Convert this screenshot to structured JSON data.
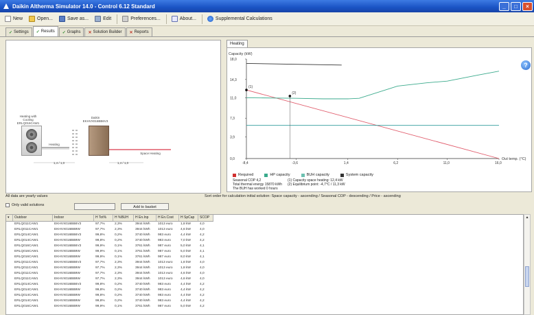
{
  "window": {
    "title": "Daikin Altherma Simulator 14.0 - Control 6.12 Standard"
  },
  "toolbar": {
    "items": [
      "New",
      "Open...",
      "Save as...",
      "Edit",
      "Preferences...",
      "About...",
      "Supplemental Calculations"
    ]
  },
  "tabs": [
    {
      "label": "Settings",
      "state": "done"
    },
    {
      "label": "Results",
      "state": "done",
      "active": true
    },
    {
      "label": "Graphs",
      "state": "done"
    },
    {
      "label": "Solution Builder",
      "state": "error"
    },
    {
      "label": "Reports",
      "state": "error"
    }
  ],
  "schematic": {
    "outdoor_label": "Heating with Cooling ERLQ016CAW1",
    "indoor_label": "Daikin EKHVX016BB6V3",
    "pipe_label": "Heating",
    "bottom_left": "1,4 / 1,0",
    "bottom_right": "1,4 / 1,0",
    "space_heating": "Space Heating"
  },
  "heating_tab": "Heating",
  "chart_data": {
    "type": "line",
    "ylabel": "Capacity (kW)",
    "xlabel": "Out temp. (°C)",
    "x_ticks": [
      "-8,4",
      "-3,6",
      "1,4",
      "6,2",
      "11,0",
      "16,0"
    ],
    "y_ticks": [
      "0,0",
      "3,9",
      "7,3",
      "11,0",
      "14,3",
      "18,0"
    ],
    "xlim": [
      -8.4,
      16.0
    ],
    "ylim": [
      0,
      18
    ],
    "series": [
      {
        "name": "Required",
        "color": "#e05a6a",
        "x": [
          -8.4,
          16.0
        ],
        "y": [
          12.4,
          0.0
        ]
      },
      {
        "name": "HP capacity",
        "color": "#3aaa8c",
        "x": [
          -8.4,
          -3.6,
          -1.0,
          1.4,
          2.5,
          6.2,
          9.0,
          11.0,
          14.0,
          16.0
        ],
        "y": [
          11.0,
          10.9,
          10.8,
          10.8,
          10.9,
          13.1,
          13.7,
          14.0,
          15.1,
          15.8
        ]
      },
      {
        "name": "BUH capacity",
        "color": "#2f9a9a",
        "x": [
          -8.4,
          16.0
        ],
        "y": [
          6.0,
          6.0
        ]
      },
      {
        "name": "System capacity",
        "color": "#333333",
        "x": [
          -8.4,
          0.8
        ],
        "y": [
          17.2,
          16.9
        ]
      }
    ],
    "markers": [
      {
        "label": "(1)",
        "x": -8.4,
        "y": 12.4
      },
      {
        "label": "(2)",
        "x": -4.2,
        "y": 11.3
      }
    ],
    "grid": false,
    "legend": "bottom"
  },
  "results": {
    "seasonal_cop_label": "Seasonal COP",
    "seasonal_cop": "4,2",
    "total_energy_label": "Total thermal energy",
    "total_energy": "15870 kWh",
    "buh_note": "The BUH has worked 0 hours",
    "cap1": "(1) Capacity space heating: 12,4 kW",
    "cap2": "(2) Equilibrium point: -4,7°C / 11,3 kW"
  },
  "filter": {
    "note": "All data are yearly values",
    "sort": "Sort order for calculation initial solution: Space capacity - ascending / Seasonal COP - descending / Price - ascending",
    "valid_only": "Only valid solutions",
    "add_label": "Add to basket"
  },
  "table": {
    "columns": [
      "Outdoor",
      "Indoor",
      "H Tot%",
      "H %BUH",
      "H En.Inp",
      "H En.Cost",
      "H SpCap",
      "SCOP"
    ],
    "rows": [
      [
        "ERLQ011CAW1",
        "EKHVX016BB6V3",
        "97,7%",
        "2,3%",
        "3944 kWh",
        "1013 euro",
        "1,8 kW",
        "4,0"
      ],
      [
        "ERLQ011CAW1",
        "EKHVX016BB9W",
        "97,7%",
        "2,3%",
        "3944 kWh",
        "1013 euro",
        "4,6 kW",
        "4,0"
      ],
      [
        "ERLQ014CAW1",
        "EKHVX016BB6V3",
        "99,8%",
        "0,2%",
        "3740 kWh",
        "983 euro",
        "4,4 kW",
        "4,2"
      ],
      [
        "ERLQ014CAW1",
        "EKHVX016BB9W",
        "99,8%",
        "0,2%",
        "3740 kWh",
        "983 euro",
        "7,0 kW",
        "4,2"
      ],
      [
        "ERLQ016CAW1",
        "EKHVX016BB6V3",
        "99,9%",
        "0,1%",
        "3761 kWh",
        "987 euro",
        "5,0 kW",
        "4,1"
      ],
      [
        "ERLQ016CAW1",
        "EKHVX016BB9W",
        "99,9%",
        "0,1%",
        "3761 kWh",
        "987 euro",
        "5,0 kW",
        "4,1"
      ],
      [
        "ERLQ016CAW1",
        "EKHVX016BB9W",
        "99,9%",
        "0,1%",
        "3761 kWh",
        "987 euro",
        "8,0 kW",
        "4,1"
      ],
      [
        "ERLQ011CAW1",
        "EKHVX016BB6V3",
        "97,7%",
        "2,3%",
        "3944 kWh",
        "1013 euro",
        "1,8 kW",
        "4,0"
      ],
      [
        "ERLQ011CAW1",
        "EKHVX016BB9W",
        "97,7%",
        "2,3%",
        "3944 kWh",
        "1013 euro",
        "1,8 kW",
        "4,0"
      ],
      [
        "ERLQ011CAW1",
        "EKHVX016BB9W",
        "97,7%",
        "2,3%",
        "3944 kWh",
        "1013 euro",
        "4,6 kW",
        "4,0"
      ],
      [
        "ERLQ011CAW1",
        "EKHVX016BB9W",
        "97,7%",
        "2,3%",
        "3944 kWh",
        "1013 euro",
        "4,6 kW",
        "4,0"
      ],
      [
        "ERLQ014CAW1",
        "EKHVX016BB6V3",
        "99,8%",
        "0,2%",
        "3740 kWh",
        "983 euro",
        "4,4 kW",
        "4,2"
      ],
      [
        "ERLQ014CAW1",
        "EKHVX016BB9W",
        "99,8%",
        "0,2%",
        "3740 kWh",
        "983 euro",
        "4,4 kW",
        "4,2"
      ],
      [
        "ERLQ014CAW1",
        "EKHVX016BB9W",
        "99,8%",
        "0,2%",
        "3740 kWh",
        "983 euro",
        "4,4 kW",
        "4,2"
      ],
      [
        "ERLQ014CAW1",
        "EKHVX016BB9W",
        "99,8%",
        "0,2%",
        "3740 kWh",
        "983 euro",
        "4,4 kW",
        "4,2"
      ],
      [
        "ERLQ016CAW1",
        "EKHVX016BB9W",
        "99,9%",
        "0,1%",
        "3761 kWh",
        "987 euro",
        "5,0 kW",
        "4,2"
      ]
    ]
  }
}
